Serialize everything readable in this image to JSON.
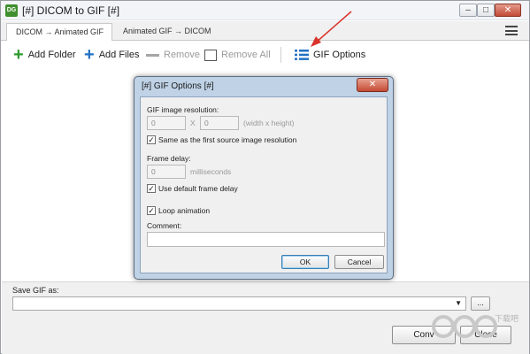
{
  "window": {
    "title": "[#] DICOM to GIF [#]",
    "app_icon_text": "DG",
    "minimize": "–",
    "maximize": "□",
    "close": "✕"
  },
  "tabs": [
    {
      "label": "DICOM → Animated GIF",
      "active": true
    },
    {
      "label": "Animated GIF → DICOM",
      "active": false
    }
  ],
  "toolbar": {
    "add_folder": "Add Folder",
    "add_files": "Add Files",
    "remove": "Remove",
    "remove_all": "Remove All",
    "gif_options": "GIF Options"
  },
  "bottom": {
    "save_label": "Save GIF as:",
    "save_value": "",
    "browse": "...",
    "convert": "Conv",
    "close": "Close"
  },
  "dialog": {
    "title": "[#] GIF Options [#]",
    "close": "✕",
    "resolution_label": "GIF image resolution:",
    "width_value": "0",
    "x_sep": "X",
    "height_value": "0",
    "resolution_hint": "(width x height)",
    "same_as_source": {
      "label": "Same as the first source image resolution",
      "checked": true
    },
    "frame_delay_label": "Frame delay:",
    "frame_delay_value": "0",
    "frame_delay_unit": "milliseconds",
    "use_default_delay": {
      "label": "Use default frame delay",
      "checked": true
    },
    "loop_animation": {
      "label": "Loop animation",
      "checked": true
    },
    "comment_label": "Comment:",
    "comment_value": "",
    "ok": "OK",
    "cancel": "Cancel"
  },
  "watermark": {
    "text": "下载吧"
  },
  "colors": {
    "accent_blue": "#2271c4",
    "green": "#2e9a2e",
    "arrow_red": "#d9342b",
    "dialog_frame": "#bfd2e6"
  }
}
